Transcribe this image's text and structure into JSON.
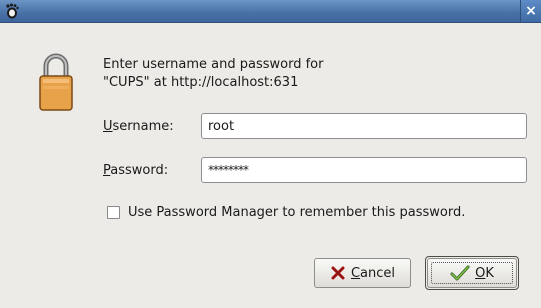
{
  "window": {
    "app_icon": "gnome-foot-icon",
    "close_icon": "close-icon",
    "close_glyph": "×"
  },
  "dialog": {
    "icon": "padlock-icon",
    "message": "Enter username and password for\n\"CUPS\" at http://localhost:631",
    "username": {
      "label_mnemonic": "U",
      "label_rest": "sername:",
      "value": "root"
    },
    "password": {
      "label_mnemonic": "P",
      "label_rest": "assword:",
      "value": "********"
    },
    "remember": {
      "label": "Use Password Manager to remember this password.",
      "checked": false
    }
  },
  "buttons": {
    "cancel": {
      "mnemonic": "C",
      "rest": "ancel",
      "icon": "cancel-x-icon"
    },
    "ok": {
      "mnemonic": "O",
      "rest": "K",
      "icon": "ok-check-icon"
    }
  }
}
